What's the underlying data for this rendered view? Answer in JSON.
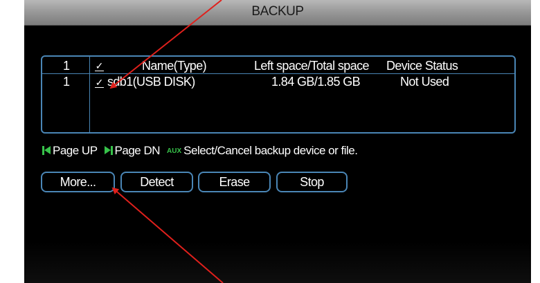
{
  "window": {
    "title": "BACKUP"
  },
  "device_table": {
    "header": {
      "index": "1",
      "checked": "✓",
      "name": "Name(Type)",
      "space": "Left space/Total space",
      "status": "Device Status"
    },
    "rows": [
      {
        "index": "1",
        "checked": "✓",
        "name": "sdb1(USB DISK)",
        "space": "1.84 GB/1.85 GB",
        "status": "Not Used"
      }
    ]
  },
  "hint": {
    "page_up": "Page UP",
    "page_down": "Page DN",
    "aux_label": "AUX",
    "aux_text": "Select/Cancel backup device or file."
  },
  "buttons": {
    "more": "More...",
    "detect": "Detect",
    "erase": "Erase",
    "stop": "Stop"
  },
  "colors": {
    "background": "#000000",
    "border_blue": "#4a86b6",
    "icon_green": "#37c24a",
    "annotation_red": "#e0201c"
  }
}
